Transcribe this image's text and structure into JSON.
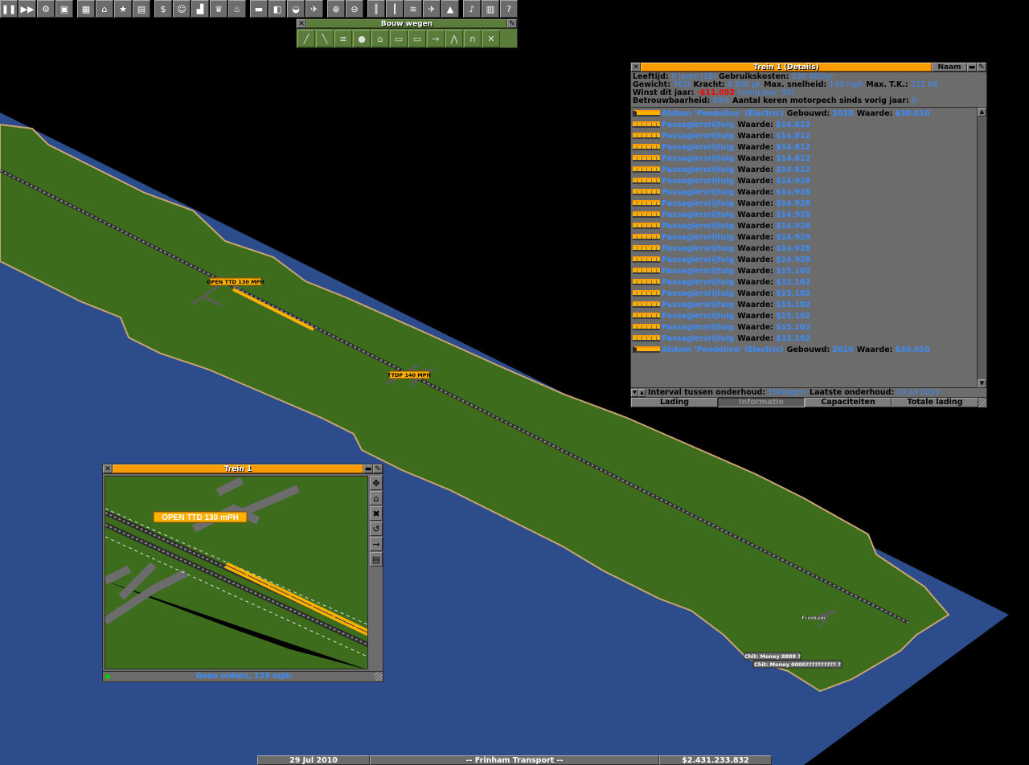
{
  "toolbar": {
    "buttons": [
      {
        "icon": "pause-icon",
        "glyph": "❚❚"
      },
      {
        "icon": "fast-forward-icon",
        "glyph": "▶▶"
      },
      {
        "icon": "options-gear-icon",
        "glyph": "⚙"
      },
      {
        "icon": "save-disk-icon",
        "glyph": "▣"
      },
      {
        "gap": true
      },
      {
        "icon": "minimap-icon",
        "glyph": "▦"
      },
      {
        "icon": "town-directory-icon",
        "glyph": "⌂"
      },
      {
        "icon": "subsidies-icon",
        "glyph": "★"
      },
      {
        "icon": "stations-list-icon",
        "glyph": "▤"
      },
      {
        "gap": true
      },
      {
        "icon": "finances-icon",
        "glyph": "$"
      },
      {
        "icon": "company-icon",
        "glyph": "☺"
      },
      {
        "icon": "graphs-icon",
        "glyph": "▟"
      },
      {
        "icon": "league-trophy-icon",
        "glyph": "♛"
      },
      {
        "icon": "industry-icon",
        "glyph": "♨"
      },
      {
        "gap": true
      },
      {
        "icon": "trains-list-icon",
        "glyph": "▬"
      },
      {
        "icon": "road-vehicles-icon",
        "glyph": "◧"
      },
      {
        "icon": "ships-icon",
        "glyph": "◒"
      },
      {
        "icon": "aircraft-icon",
        "glyph": "✈"
      },
      {
        "gap": true
      },
      {
        "icon": "zoom-in-icon",
        "glyph": "⊕"
      },
      {
        "icon": "zoom-out-icon",
        "glyph": "⊖"
      },
      {
        "gap": true
      },
      {
        "icon": "build-rail-icon",
        "glyph": "║"
      },
      {
        "icon": "build-road-icon",
        "glyph": "┃"
      },
      {
        "icon": "build-water-icon",
        "glyph": "≋"
      },
      {
        "icon": "build-airport-icon",
        "glyph": "✈"
      },
      {
        "icon": "landscaping-icon",
        "glyph": "▲"
      },
      {
        "gap": true
      },
      {
        "icon": "music-sound-icon",
        "glyph": "♪"
      },
      {
        "icon": "news-messages-icon",
        "glyph": "▥"
      },
      {
        "icon": "help-icon",
        "glyph": "?"
      }
    ]
  },
  "road_toolbar": {
    "title": "Bouw wegen",
    "tools": [
      {
        "icon": "road-x-icon",
        "glyph": "╱"
      },
      {
        "icon": "road-y-icon",
        "glyph": "╲"
      },
      {
        "icon": "auto-road-icon",
        "glyph": "≡"
      },
      {
        "icon": "demolish-bomb-icon",
        "glyph": "●"
      },
      {
        "icon": "road-depot-icon",
        "glyph": "⌂"
      },
      {
        "icon": "bus-station-icon",
        "glyph": "▭"
      },
      {
        "icon": "truck-station-icon",
        "glyph": "▭"
      },
      {
        "icon": "one-way-icon",
        "glyph": "→"
      },
      {
        "icon": "road-bridge-icon",
        "glyph": "⋀"
      },
      {
        "icon": "road-tunnel-icon",
        "glyph": "∩"
      },
      {
        "icon": "remove-road-icon",
        "glyph": "✕"
      }
    ]
  },
  "details": {
    "title": "Trein 1 (Details)",
    "naam_button": "Naam",
    "line1": {
      "age_label": "Leeftijd:",
      "age_value": "0 jaren (18)",
      "cost_label": "Gebruikskosten:",
      "cost_value": "$26.860/yr"
    },
    "line2": {
      "weight_label": "Gewicht:",
      "weight_value": "762t",
      "power_label": "Kracht:",
      "power_value": "6.800 pk",
      "speed_label": "Max. snelheid:",
      "speed_value": "140 mph",
      "te_label": "Max. T.K.:",
      "te_value": "211 kN"
    },
    "line3": {
      "profit_label": "Winst dit jaar:",
      "profit_value": "-$11.052",
      "last_year": "(vorig jaar: $0)"
    },
    "line4": {
      "rel_label": "Betrouwbaarheid:",
      "rel_value": "89%",
      "break_label": "Aantal keren motorpech sinds vorig jaar:",
      "break_value": "0"
    },
    "vehicles": [
      {
        "name": "Alstom 'Pendolino' (Electric)",
        "built_label": "Gebouwd:",
        "built": "2010",
        "value_label": "Waarde:",
        "value": "$30.010",
        "loco": true
      },
      {
        "name": "Passagiersrijtuig",
        "value_label": "Waarde:",
        "value": "$14.812"
      },
      {
        "name": "Passagiersrijtuig",
        "value_label": "Waarde:",
        "value": "$14.812"
      },
      {
        "name": "Passagiersrijtuig",
        "value_label": "Waarde:",
        "value": "$14.812"
      },
      {
        "name": "Passagiersrijtuig",
        "value_label": "Waarde:",
        "value": "$14.812"
      },
      {
        "name": "Passagiersrijtuig",
        "value_label": "Waarde:",
        "value": "$14.812"
      },
      {
        "name": "Passagiersrijtuig",
        "value_label": "Waarde:",
        "value": "$14.928"
      },
      {
        "name": "Passagiersrijtuig",
        "value_label": "Waarde:",
        "value": "$14.928"
      },
      {
        "name": "Passagiersrijtuig",
        "value_label": "Waarde:",
        "value": "$14.928"
      },
      {
        "name": "Passagiersrijtuig",
        "value_label": "Waarde:",
        "value": "$14.928"
      },
      {
        "name": "Passagiersrijtuig",
        "value_label": "Waarde:",
        "value": "$14.928"
      },
      {
        "name": "Passagiersrijtuig",
        "value_label": "Waarde:",
        "value": "$14.928"
      },
      {
        "name": "Passagiersrijtuig",
        "value_label": "Waarde:",
        "value": "$14.928"
      },
      {
        "name": "Passagiersrijtuig",
        "value_label": "Waarde:",
        "value": "$14.928"
      },
      {
        "name": "Passagiersrijtuig",
        "value_label": "Waarde:",
        "value": "$15.102"
      },
      {
        "name": "Passagiersrijtuig",
        "value_label": "Waarde:",
        "value": "$15.102"
      },
      {
        "name": "Passagiersrijtuig",
        "value_label": "Waarde:",
        "value": "$15.102"
      },
      {
        "name": "Passagiersrijtuig",
        "value_label": "Waarde:",
        "value": "$15.102"
      },
      {
        "name": "Passagiersrijtuig",
        "value_label": "Waarde:",
        "value": "$15.102"
      },
      {
        "name": "Passagiersrijtuig",
        "value_label": "Waarde:",
        "value": "$15.102"
      },
      {
        "name": "Passagiersrijtuig",
        "value_label": "Waarde:",
        "value": "$15.102"
      },
      {
        "name": "Alstom 'Pendolino' (Electric)",
        "built_label": "Gebouwd:",
        "built": "2010",
        "value_label": "Waarde:",
        "value": "$30.010",
        "loco": true
      }
    ],
    "service": {
      "interval_label": "Interval tussen onderhoud:",
      "interval_value": "150dagen",
      "last_label": "Laatste onderhoud:",
      "last_value": "10 Jul 2010"
    },
    "tabs": [
      "Lading",
      "Informatie",
      "Capaciteiten",
      "Totale lading"
    ],
    "active_tab": 1
  },
  "train_window": {
    "title": "Trein 1",
    "viewport_sign": "OPEN TTD 130 mPH",
    "status": "Geen orders, 129 mph",
    "side_buttons": [
      {
        "icon": "center-view-icon",
        "glyph": "✥"
      },
      {
        "icon": "send-to-depot-icon",
        "glyph": "⌂"
      },
      {
        "icon": "ignore-signal-icon",
        "glyph": "✖"
      },
      {
        "icon": "turn-around-icon",
        "glyph": "↺"
      },
      {
        "icon": "orders-icon",
        "glyph": "→"
      },
      {
        "icon": "details-icon",
        "glyph": "▤"
      }
    ]
  },
  "map": {
    "sign_1": "OPEN TTD 130 MPH",
    "sign_2": "TTDP 140 MPH",
    "town": "Frinham",
    "cheat_1": "Chit: Money 8888 ?",
    "cheat_2": "Chit: Money 0000?????????? ?"
  },
  "statusbar": {
    "date": "29 Jul 2010",
    "company": "-- Frinham Transport --",
    "money": "$2.431.233.832"
  },
  "colors": {
    "sea": "#2c4c8c",
    "grass": "#3c6c1c",
    "window_grey": "#6c6c6c",
    "title_orange": "#f89c00",
    "value_blue": "#3c8cfc",
    "negative_red": "#fc0000"
  }
}
